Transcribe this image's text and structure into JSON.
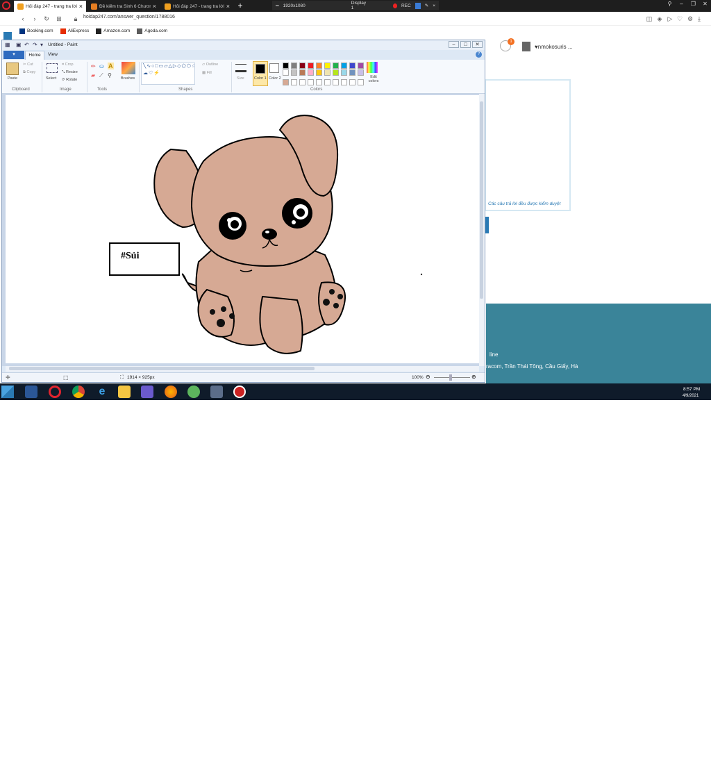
{
  "browser": {
    "tabs": [
      {
        "label": "Hỏi đáp 247 - trang tra lời",
        "active": true,
        "favicon_color": "#f0a020"
      },
      {
        "label": "Đề kiểm tra Sinh 6 Chương",
        "active": false,
        "favicon_color": "#e67e22"
      },
      {
        "label": "Hỏi đáp 247 - trang tra lời",
        "active": false,
        "favicon_color": "#f0a020"
      }
    ],
    "url": "hoidap247.com/answer_question/1788016",
    "bookmarks": [
      {
        "label": "Booking.com",
        "color": "#003580"
      },
      {
        "label": "AliExpress",
        "color": "#e62e04"
      },
      {
        "label": "Amazon.com",
        "color": "#222222"
      },
      {
        "label": "Agoda.com",
        "color": "#5c5c5c"
      }
    ],
    "recorder": {
      "resolution": "1920x1080",
      "display": "Display 1",
      "rec": "REC"
    }
  },
  "page": {
    "username": "♥nmokosuris ...",
    "notification_count": "1",
    "card_note": "Các câu trả lời đều được kiểm duyệt",
    "footer_line1": "line",
    "footer_line2": "racom, Trần Thái Tông, Cầu Giấy, Hà"
  },
  "paint": {
    "title": "Untitled - Paint",
    "tabs": {
      "file": "▾",
      "home": "Home",
      "view": "View"
    },
    "ribbon": {
      "paste": "Paste",
      "cut": "Cut",
      "copy": "Copy",
      "select": "Select",
      "crop": "Crop",
      "resize": "Resize",
      "rotate": "Rotate",
      "brushes": "Brushes",
      "outline": "Outline",
      "fill": "Fill",
      "size": "Size",
      "color1": "Color 1",
      "color2": "Color 2",
      "edit_colors": "Edit colors",
      "groups": {
        "clipboard": "Clipboard",
        "image": "Image",
        "tools": "Tools",
        "shapes": "Shapes",
        "colors": "Colors"
      }
    },
    "palette": [
      "#000000",
      "#7f7f7f",
      "#880015",
      "#ed1c24",
      "#ff7f27",
      "#fff200",
      "#22b14c",
      "#00a2e8",
      "#3f48cc",
      "#a349a4",
      "#ffffff",
      "#c3c3c3",
      "#b97a57",
      "#ffaec9",
      "#ffc90e",
      "#efe4b0",
      "#b5e61d",
      "#99d9ea",
      "#7092be",
      "#c8bfe7"
    ],
    "canvas_text": "#Sủi",
    "status_size": "1914 × 925px",
    "zoom": "100%",
    "colors": {
      "dog_fur": "#d6a994",
      "outline": "#000000"
    }
  },
  "taskbar": {
    "time": "8:57 PM",
    "date": "4/9/2021",
    "lang": "EN"
  }
}
